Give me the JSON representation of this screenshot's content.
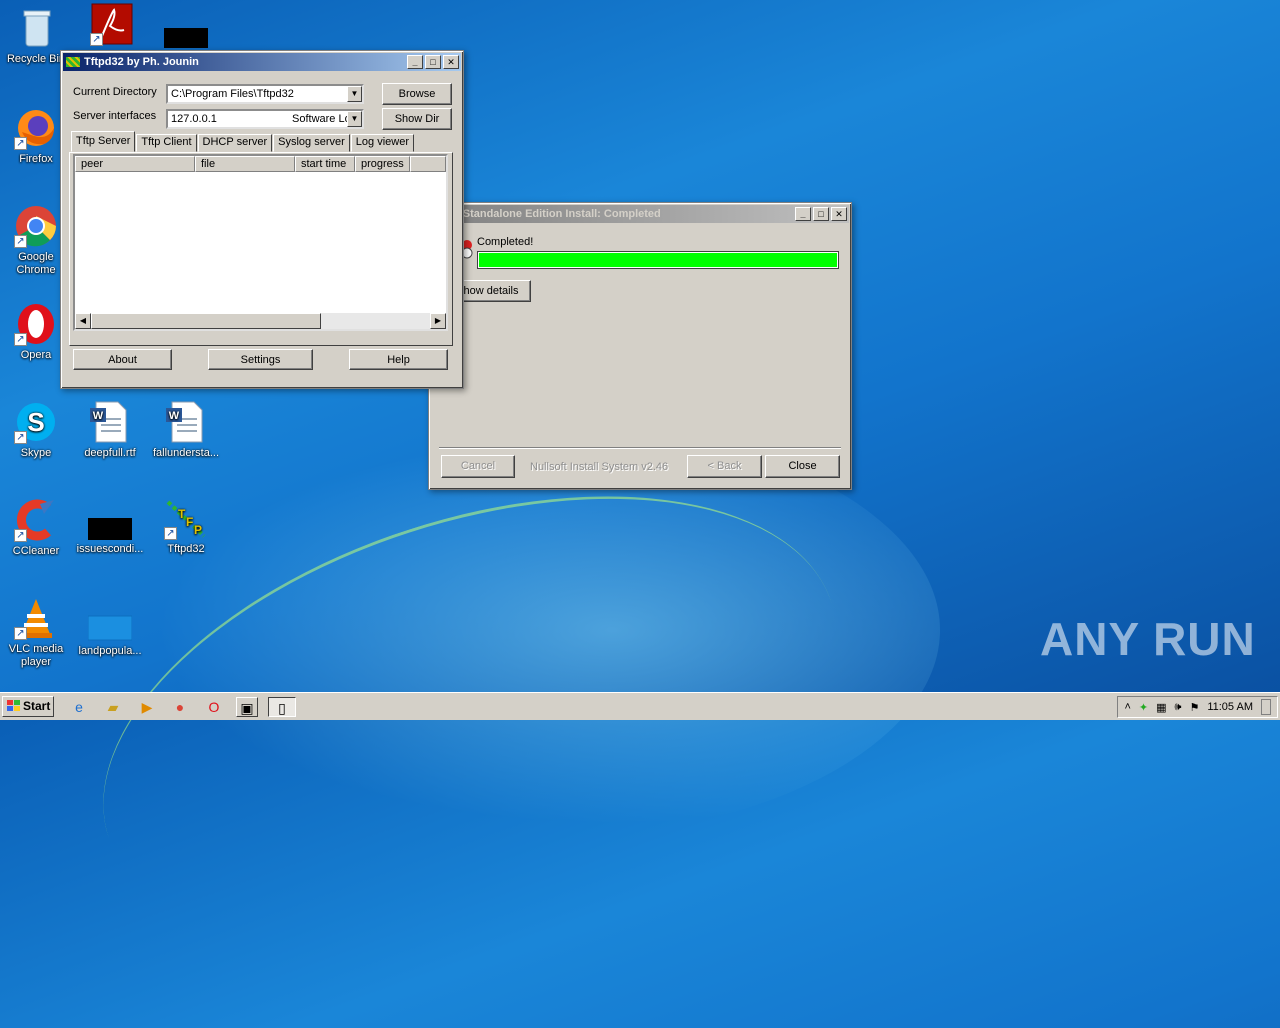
{
  "desktop": {
    "icons": [
      {
        "label": "Recycle Bin",
        "icon": "recycle-bin-icon"
      },
      {
        "label": "Firefox",
        "icon": "firefox-icon"
      },
      {
        "label": "Google Chrome",
        "icon": "chrome-icon"
      },
      {
        "label": "Opera",
        "icon": "opera-icon"
      },
      {
        "label": "Skype",
        "icon": "skype-icon"
      },
      {
        "label": "CCleaner",
        "icon": "ccleaner-icon"
      },
      {
        "label": "VLC media player",
        "icon": "vlc-icon"
      },
      {
        "label": "deepfull.rtf",
        "icon": "word-document-icon"
      },
      {
        "label": "issuescondi...",
        "icon": "black-file-icon"
      },
      {
        "label": "landpopula...",
        "icon": "blank-file-icon"
      },
      {
        "label": "fallundersta...",
        "icon": "word-document-icon"
      },
      {
        "label": "Tftpd32",
        "icon": "tftpd32-icon"
      }
    ]
  },
  "tftpd_window": {
    "title": "Tftpd32 by Ph. Jounin",
    "current_directory_label": "Current Directory",
    "current_directory_value": "C:\\Program Files\\Tftpd32",
    "server_interfaces_label": "Server interfaces",
    "server_interfaces_value": "127.0.0.1",
    "server_interfaces_value2": "Software Lo",
    "browse_label": "Browse",
    "show_dir_label": "Show Dir",
    "tabs": [
      "Tftp Server",
      "Tftp Client",
      "DHCP server",
      "Syslog server",
      "Log viewer"
    ],
    "columns": [
      "peer",
      "file",
      "start time",
      "progress"
    ],
    "about_label": "About",
    "settings_label": "Settings",
    "help_label": "Help"
  },
  "installer_window": {
    "title": "pd32 Standalone Edition Install: Completed",
    "status": "Completed!",
    "progress": 1.0,
    "show_details_label": "how details",
    "cancel_label": "Cancel",
    "branding": "Nullsoft Install System v2.46",
    "back_label": "< Back",
    "close_label": "Close"
  },
  "taskbar": {
    "start_label": "Start",
    "clock": "11:05 AM"
  },
  "watermark": "ANY RUN",
  "colors": {
    "progress_fill": "#00ff00",
    "title_active": "#0a246a"
  }
}
